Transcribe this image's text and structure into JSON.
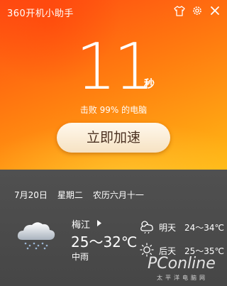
{
  "app": {
    "title": "360开机小助手"
  },
  "boot": {
    "seconds": "11",
    "unit": "秒",
    "beat_text": "击败 99% 的电脑",
    "speedup_label": "立即加速"
  },
  "weather": {
    "date": "7月20日",
    "weekday": "星期二",
    "lunar": "农历六月十一",
    "city": "梅江",
    "today_temp": "25～32℃",
    "today_desc": "中雨",
    "forecast": [
      {
        "label": "明天",
        "temp": "24～34℃",
        "icon": "cloudy-rain-icon"
      },
      {
        "label": "后天",
        "temp": "25～35℃",
        "icon": "sun-icon"
      }
    ]
  },
  "watermark": {
    "brand": "PConline",
    "sub": "太平洋电脑网"
  },
  "colors": {
    "accent_top": "#ff4a12",
    "accent_bottom": "#ffb814",
    "panel": "#4e4e4e",
    "button_text": "#4a3020"
  }
}
